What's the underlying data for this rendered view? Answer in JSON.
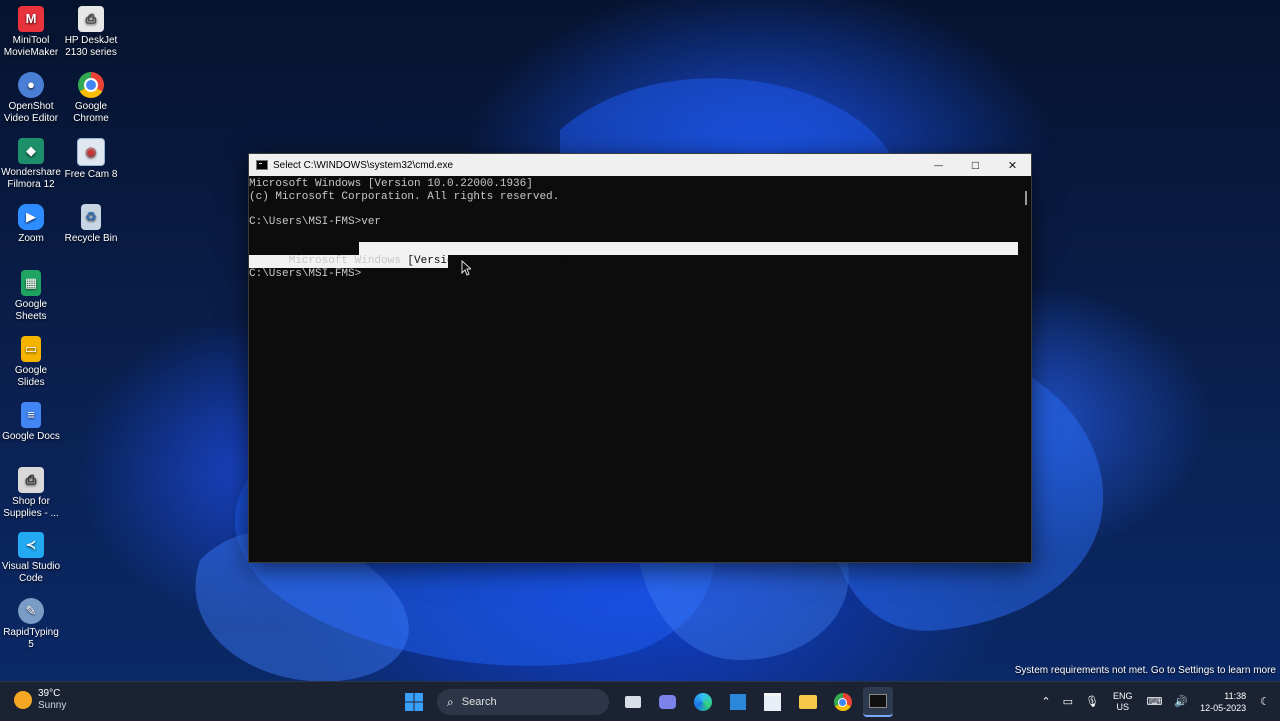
{
  "desktop_icons": [
    {
      "label": "MiniTool\nMovieMaker",
      "icon": "minitool-icon",
      "color": "#e8323c"
    },
    {
      "label": "HP DeskJet\n2130 series",
      "icon": "printer-icon",
      "color": "#e7e7e7"
    },
    {
      "label": "OpenShot\nVideo Editor",
      "icon": "openshot-icon",
      "color": "#4a7fd6"
    },
    {
      "label": "Google\nChrome",
      "icon": "chrome-icon",
      "color": "#4caf50"
    },
    {
      "label": "Wondershare\nFilmora 12",
      "icon": "filmora-icon",
      "color": "#1e8f6b"
    },
    {
      "label": "Free Cam 8",
      "icon": "freecam-icon",
      "color": "#9ab6d6"
    },
    {
      "label": "Zoom",
      "icon": "zoom-icon",
      "color": "#2d8cff"
    },
    {
      "label": "Recycle Bin",
      "icon": "recycle-bin-icon",
      "color": "#c7d4e2"
    },
    {
      "label": "Google\nSheets",
      "icon": "sheets-icon",
      "color": "#1fa463"
    },
    {
      "label": "Google Slides",
      "icon": "slides-icon",
      "color": "#f4b400"
    },
    {
      "label": "Google Docs",
      "icon": "docs-icon",
      "color": "#4285f4"
    },
    {
      "label": "Shop for\nSupplies - ...",
      "icon": "shop-supplies-icon",
      "color": "#d9d9d9"
    },
    {
      "label": "Visual Studio\nCode",
      "icon": "vscode-icon",
      "color": "#23a9f2"
    },
    {
      "label": "RapidTyping\n5",
      "icon": "rapidtyping-icon",
      "color": "#7a9cc6"
    }
  ],
  "cmd": {
    "title": "Select C:\\WINDOWS\\system32\\cmd.exe",
    "minimize": "—",
    "maximize": "□",
    "close": "✕",
    "line1": "Microsoft Windows [Version 10.0.22000.1936]",
    "line2": "(c) Microsoft Corporation. All rights reserved.",
    "line3": "C:\\Users\\MSI-FMS>ver",
    "line4_part1": "Microsoft Windows",
    "line4_part2": " [Version 10.0.22000.1936]",
    "line5": "C:\\Users\\MSI-FMS>"
  },
  "notice": "System requirements not met. Go to Settings to learn more",
  "taskbar": {
    "weather_temp": "39°C",
    "weather_cond": "Sunny",
    "search_placeholder": "Search",
    "lang_top": "ENG",
    "lang_bottom": "US",
    "time": "11:38",
    "date": "12-05-2023",
    "pinned": [
      "start-icon",
      "task-view-icon",
      "chat-icon",
      "edge-icon",
      "store-tile-icon",
      "microsoft-store-icon",
      "file-explorer-icon",
      "chrome-icon",
      "terminal-icon"
    ],
    "tray_icons": [
      "chevron-up-icon",
      "battery-icon",
      "microphone-icon",
      "network-icon",
      "volume-icon",
      "notification-icon"
    ]
  },
  "colors": {
    "cmd_bg": "#0c0c0c",
    "cmd_text": "#c8c8c8",
    "selection": "#f2f2f2",
    "taskbar": "#1b2333"
  }
}
